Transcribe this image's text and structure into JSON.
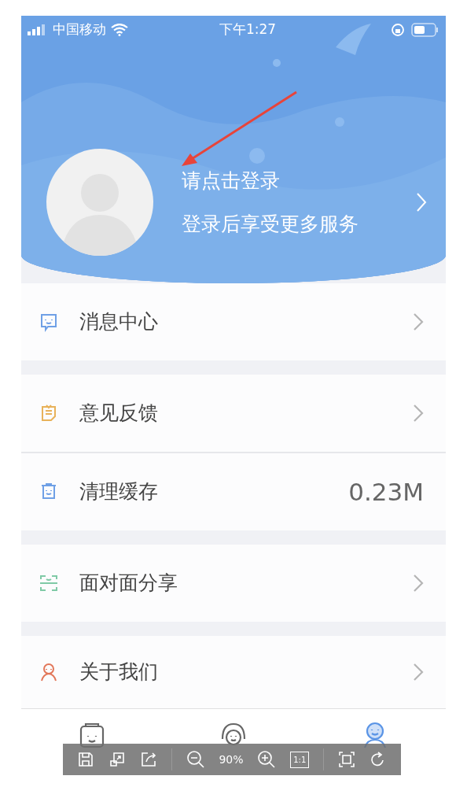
{
  "status_bar": {
    "carrier": "中国移动",
    "time": "下午1:27"
  },
  "profile": {
    "title": "请点击登录",
    "subtitle": "登录后享受更多服务"
  },
  "menu_groups": [
    [
      {
        "label": "消息中心",
        "kind": "link",
        "color": "#6fa0e6"
      }
    ],
    [
      {
        "label": "意见反馈",
        "kind": "link",
        "color": "#e8b25a"
      },
      {
        "label": "清理缓存",
        "kind": "value",
        "value": "0.23M",
        "color": "#6fa0e6"
      }
    ],
    [
      {
        "label": "面对面分享",
        "kind": "link",
        "color": "#7fcaa6"
      }
    ],
    [
      {
        "label": "关于我们",
        "kind": "link",
        "color": "#e2775a"
      }
    ]
  ],
  "tab_bar": [
    {
      "selected": false
    },
    {
      "selected": false
    },
    {
      "selected": true
    }
  ],
  "viewer_toolbar": {
    "zoom": "90%",
    "actual_size": "1:1"
  }
}
